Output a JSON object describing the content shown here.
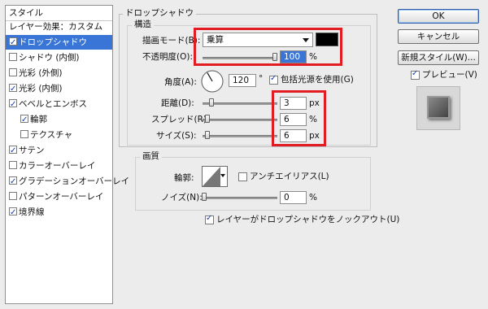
{
  "styles_list": {
    "header": "スタイル",
    "items": [
      {
        "label": "レイヤー効果：カスタム",
        "checkbox": false,
        "checked": false,
        "selected": false,
        "indent": 0
      },
      {
        "label": "ドロップシャドウ",
        "checkbox": true,
        "checked": true,
        "selected": true,
        "indent": 0
      },
      {
        "label": "シャドウ (内側)",
        "checkbox": true,
        "checked": false,
        "selected": false,
        "indent": 0
      },
      {
        "label": "光彩 (外側)",
        "checkbox": true,
        "checked": false,
        "selected": false,
        "indent": 0
      },
      {
        "label": "光彩 (内側)",
        "checkbox": true,
        "checked": true,
        "selected": false,
        "indent": 0
      },
      {
        "label": "ベベルとエンボス",
        "checkbox": true,
        "checked": true,
        "selected": false,
        "indent": 0
      },
      {
        "label": "輪郭",
        "checkbox": true,
        "checked": true,
        "selected": false,
        "indent": 1
      },
      {
        "label": "テクスチャ",
        "checkbox": true,
        "checked": false,
        "selected": false,
        "indent": 1
      },
      {
        "label": "サテン",
        "checkbox": true,
        "checked": true,
        "selected": false,
        "indent": 0
      },
      {
        "label": "カラーオーバーレイ",
        "checkbox": true,
        "checked": false,
        "selected": false,
        "indent": 0
      },
      {
        "label": "グラデーションオーバーレイ",
        "checkbox": true,
        "checked": true,
        "selected": false,
        "indent": 0
      },
      {
        "label": "パターンオーバーレイ",
        "checkbox": true,
        "checked": false,
        "selected": false,
        "indent": 0
      },
      {
        "label": "境界線",
        "checkbox": true,
        "checked": true,
        "selected": false,
        "indent": 0
      }
    ]
  },
  "drop_shadow": {
    "title": "ドロップシャドウ",
    "structure_title": "構造",
    "blend_mode_label": "描画モード(B):",
    "blend_mode_value": "乗算",
    "shadow_color": "#000000",
    "opacity_label": "不透明度(O):",
    "opacity_value": "100",
    "opacity_unit": "%",
    "opacity_level": 1.0,
    "angle_label": "角度(A):",
    "angle_value": "120",
    "angle_unit": "°",
    "global_light_label": "包括光源を使用(G)",
    "global_light_checked": true,
    "distance_label": "距離(D):",
    "distance_value": "3",
    "distance_unit": "px",
    "spread_label": "スプレッド(R):",
    "spread_value": "6",
    "spread_unit": "%",
    "size_label": "サイズ(S):",
    "size_value": "6",
    "size_unit": "px"
  },
  "quality": {
    "title": "画質",
    "contour_label": "輪郭:",
    "anti_alias_label": "アンチエイリアス(L)",
    "anti_alias_checked": false,
    "noise_label": "ノイズ(N):",
    "noise_value": "0",
    "noise_unit": "%",
    "knockout_label": "レイヤーがドロップシャドウをノックアウト(U)",
    "knockout_checked": true
  },
  "buttons": {
    "ok": "OK",
    "cancel": "キャンセル",
    "new_style": "新規スタイル(W)..."
  },
  "preview": {
    "label": "プレビュー(V)",
    "checked": true
  },
  "colors": {
    "selection": "#3875d7",
    "highlight_box": "#e31b23"
  }
}
